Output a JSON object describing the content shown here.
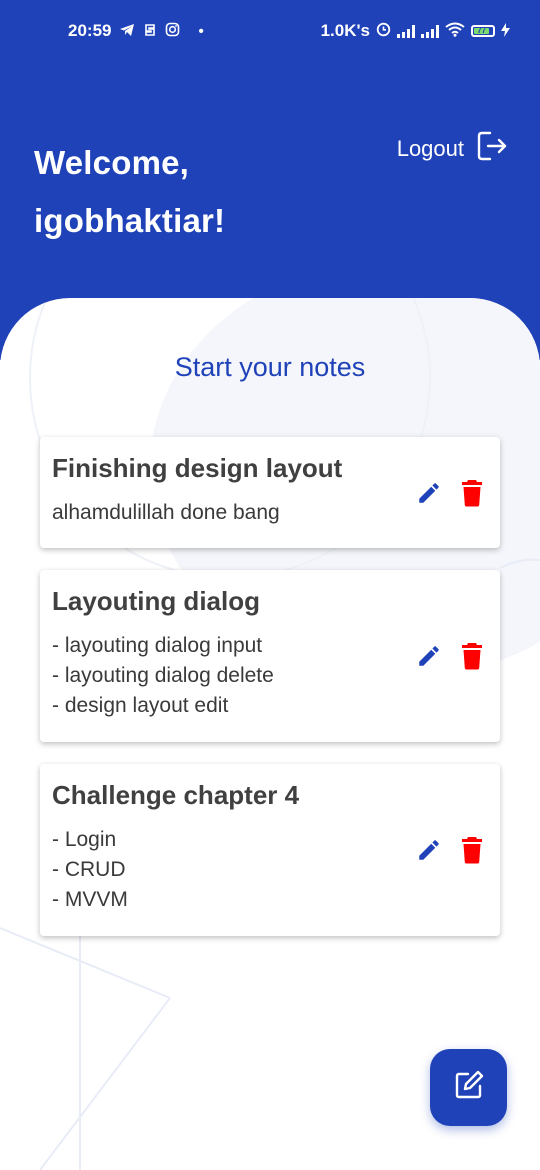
{
  "status_bar": {
    "time": "20:59",
    "net_speed": "1.0K's",
    "battery": "77"
  },
  "header": {
    "welcome_line1": "Welcome,",
    "welcome_line2": "igobhaktiar!",
    "logout_label": "Logout",
    "bg_color": "#1f42b8"
  },
  "main": {
    "subtitle": "Start your notes",
    "notes": [
      {
        "title": "Finishing design layout",
        "lines": [
          "alhamdulillah done bang"
        ]
      },
      {
        "title": "Layouting dialog",
        "lines": [
          "- layouting dialog input",
          "- layouting dialog delete",
          "- design layout edit"
        ]
      },
      {
        "title": "Challenge chapter 4",
        "lines": [
          "- Login",
          "- CRUD",
          "- MVVM"
        ]
      }
    ]
  },
  "colors": {
    "accent": "#1f42b8",
    "delete": "#ff0000",
    "edit": "#1f42b8"
  },
  "icons": {
    "edit": "pencil-icon",
    "delete": "trash-icon",
    "logout": "logout-icon",
    "fab": "edit-note-icon"
  }
}
